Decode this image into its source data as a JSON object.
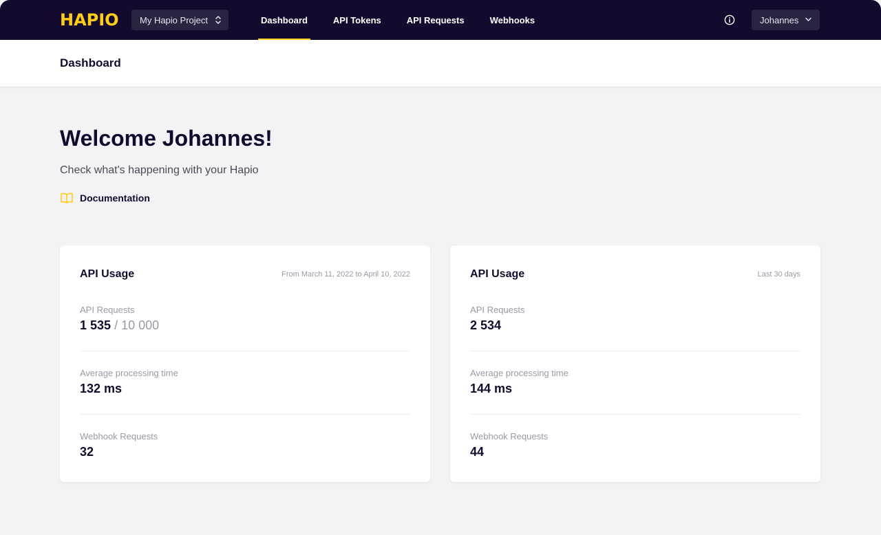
{
  "header": {
    "logo_text": "HAPIO",
    "project_select": "My Hapio Project",
    "nav": [
      {
        "label": "Dashboard",
        "active": true
      },
      {
        "label": "API Tokens",
        "active": false
      },
      {
        "label": "API Requests",
        "active": false
      },
      {
        "label": "Webhooks",
        "active": false
      }
    ],
    "user": "Johannes"
  },
  "page": {
    "title": "Dashboard",
    "welcome": "Welcome Johannes!",
    "subtitle": "Check what's happening with your Hapio",
    "doc_link": "Documentation"
  },
  "cards": [
    {
      "title": "API Usage",
      "range": "From March 11, 2022 to April 10, 2022",
      "requests_label": "API Requests",
      "requests_value": "1 535",
      "requests_limit": "/ 10 000",
      "avg_label": "Average processing time",
      "avg_value": "132 ms",
      "webhook_label": "Webhook Requests",
      "webhook_value": "32"
    },
    {
      "title": "API Usage",
      "range": "Last 30 days",
      "requests_label": "API Requests",
      "requests_value": "2 534",
      "avg_label": "Average processing time",
      "avg_value": "144 ms",
      "webhook_label": "Webhook Requests",
      "webhook_value": "44"
    }
  ],
  "colors": {
    "nav_bg": "#130a2e",
    "accent": "#ffcc1a",
    "page_bg": "#f2f3f5",
    "text_dark": "#130a2e",
    "text_muted": "#9a99a6"
  },
  "icons": {
    "project_select": "chevron-up-down-icon",
    "info": "info-circle-icon",
    "user_menu": "chevron-down-icon",
    "doc": "book-open-icon"
  }
}
